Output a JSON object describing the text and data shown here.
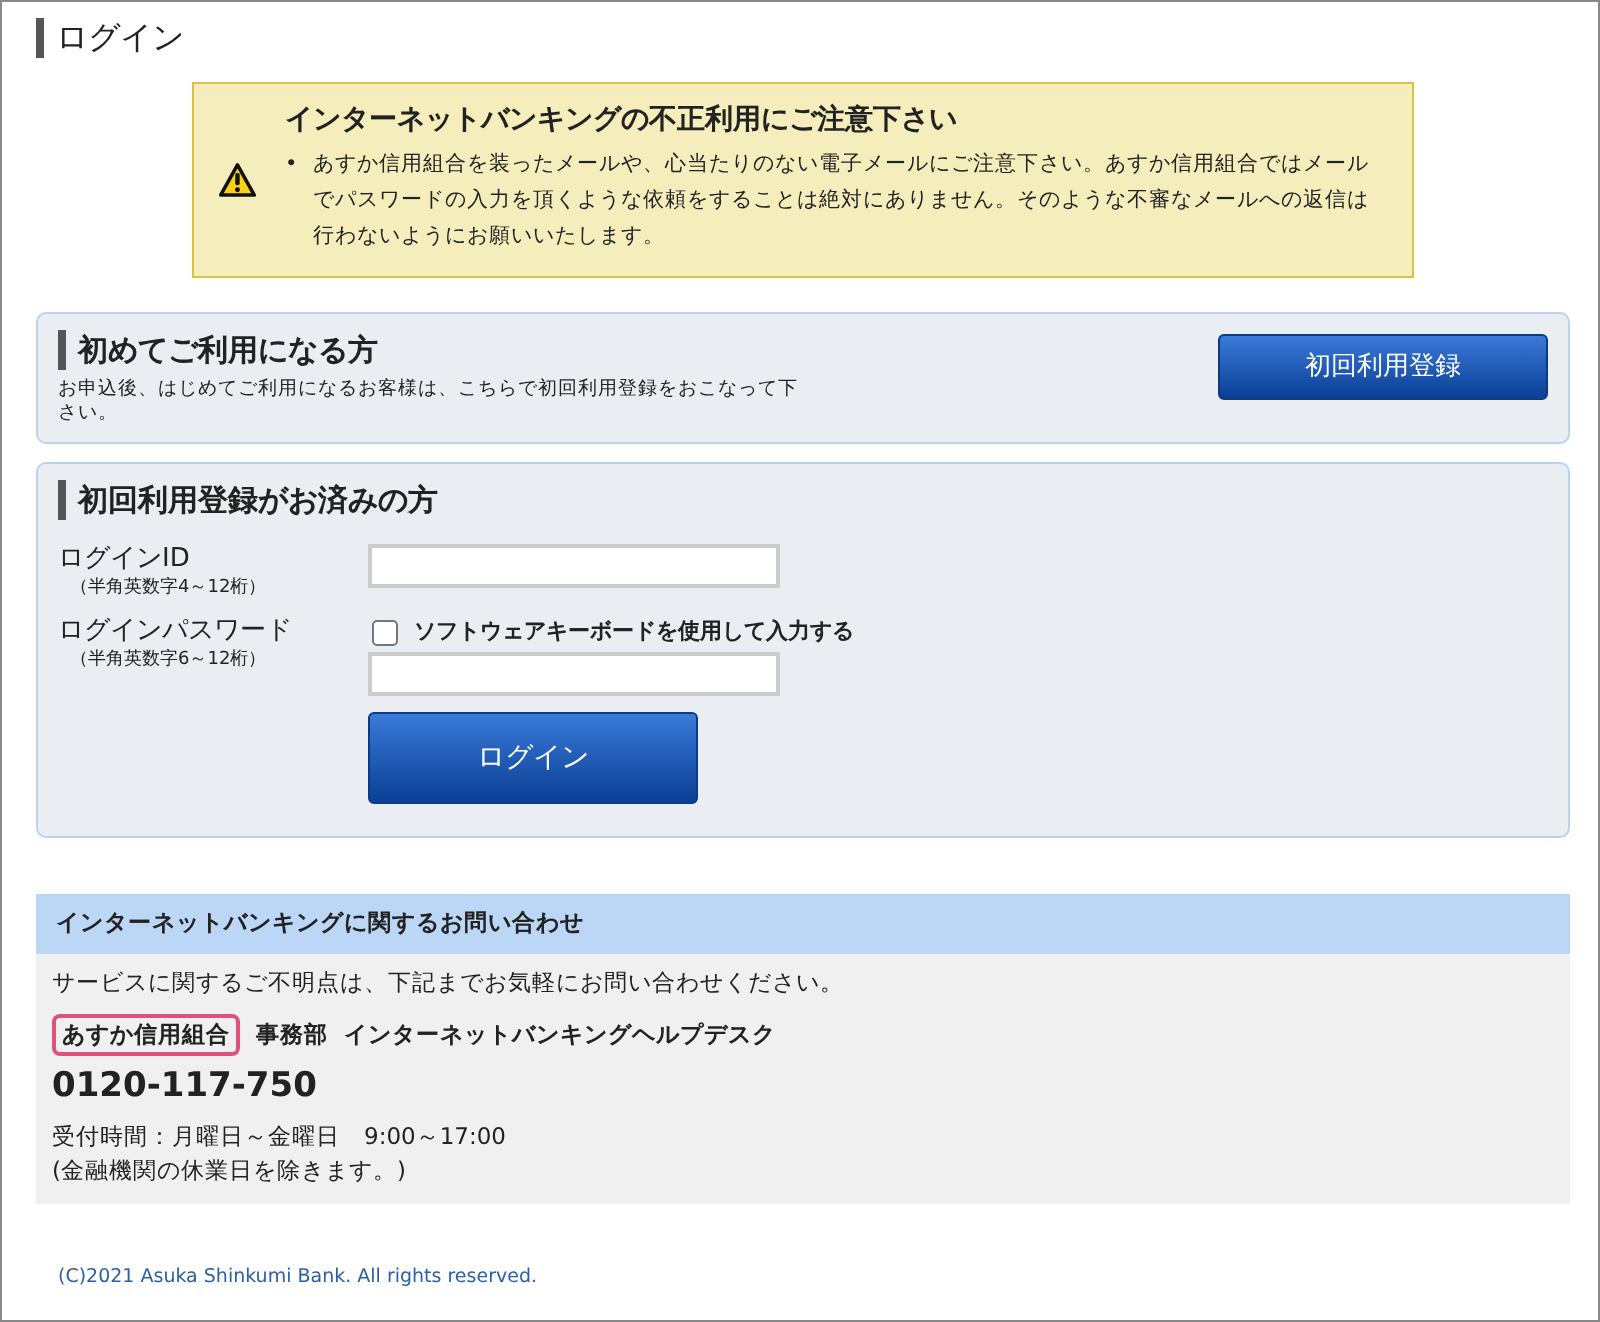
{
  "page_title": "ログイン",
  "warning": {
    "title": "インターネットバンキングの不正利用にご注意下さい",
    "items": [
      {
        "bullet": "•",
        "text": "あすか信用組合を装ったメールや、心当たりのない電子メールにご注意下さい。あすか信用組合ではメールでパスワードの入力を頂くような依頼をすることは絶対にありません。そのような不審なメールへの返信は行わないようにお願いいたします。"
      }
    ]
  },
  "first_time": {
    "heading": "初めてご利用になる方",
    "description": "お申込後、はじめてご利用になるお客様は、こちらで初回利用登録をおこなって下さい。",
    "button": "初回利用登録"
  },
  "login": {
    "heading": "初回利用登録がお済みの方",
    "fields": [
      {
        "label": "ログインID",
        "hint": "（半角英数字4～12桁）"
      },
      {
        "label": "ログインパスワード",
        "hint": "（半角英数字6～12桁）",
        "option": {
          "label": "ソフトウェアキーボードを使用して入力する",
          "checked": false
        }
      }
    ],
    "button": "ログイン"
  },
  "contact": {
    "heading": "インターネットバンキングに関するお問い合わせ",
    "intro": "サービスに関するご不明点は、下記までお気軽にお問い合わせください。",
    "org": "あすか信用組合",
    "dept": "事務部",
    "desk": "インターネットバンキングヘルプデスク",
    "phone": "0120-117-750",
    "hours": "受付時間：月曜日～金曜日　9:00～17:00",
    "note": "(金融機関の休業日を除きます。)"
  },
  "footer": "(C)2021 Asuka Shinkumi Bank. All rights reserved."
}
